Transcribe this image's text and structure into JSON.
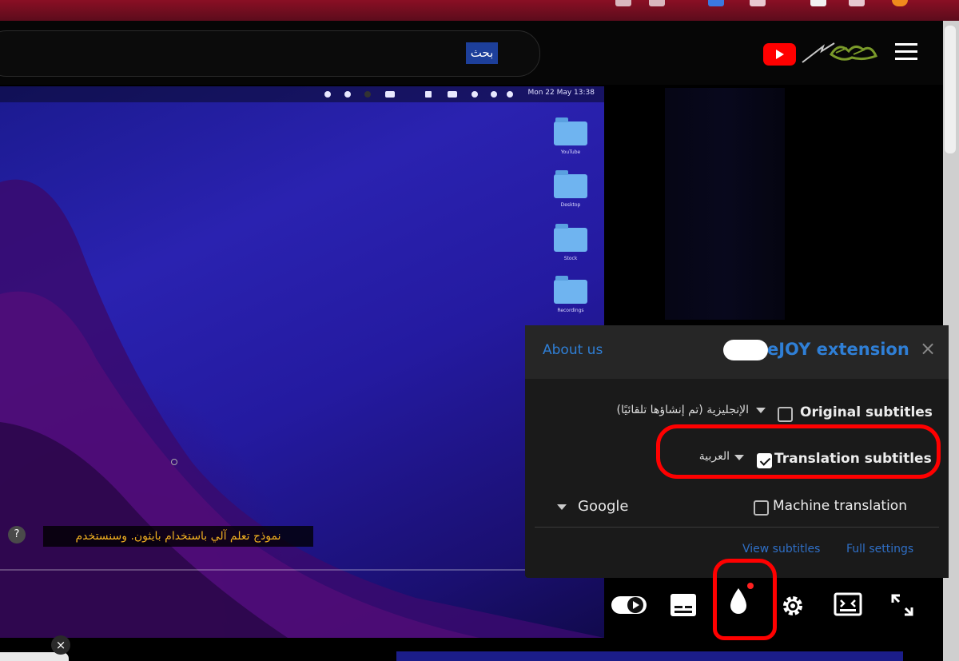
{
  "header": {
    "search_button_label": "بحث",
    "youtube_logo": "youtube-play-icon",
    "channel_logo": "channel-logo",
    "menu_icon": "hamburger-menu-icon"
  },
  "video": {
    "menubar_clock": "Mon 22 May  13:38",
    "desktop_folders": [
      "YouTube",
      "Desktop",
      "Stock",
      "Recordings"
    ],
    "subtitle_text": "نموذج تعلم آلي باستخدام بايثون. وسنستخدم",
    "help_badge": "?"
  },
  "ejoy_panel": {
    "about_label": "About us",
    "title": "eJOY extension",
    "close_label": "×",
    "original_subtitles": {
      "label": "Original subtitles",
      "checked": false,
      "language": "الإنجليزية (تم إنشاؤها تلقائيًا)"
    },
    "translation_subtitles": {
      "label": "Translation subtitles",
      "checked": true,
      "language": "العربية"
    },
    "machine_translation": {
      "label": "Machine translation",
      "checked": false,
      "engine": "Google"
    },
    "view_subtitles_label": "View subtitles",
    "full_settings_label": "Full settings"
  },
  "controls": {
    "icons": [
      "autoplay-toggle-icon",
      "subtitles-icon",
      "ejoy-drop-icon",
      "settings-gear-icon",
      "miniplayer-icon",
      "fullscreen-icon"
    ]
  },
  "colors": {
    "accent_blue": "#2f7fd6",
    "annotation_red": "#ff0000",
    "subtitle_yellow": "#f0b020",
    "youtube_red": "#ff0000"
  },
  "bottom": {
    "close_label": "×"
  }
}
